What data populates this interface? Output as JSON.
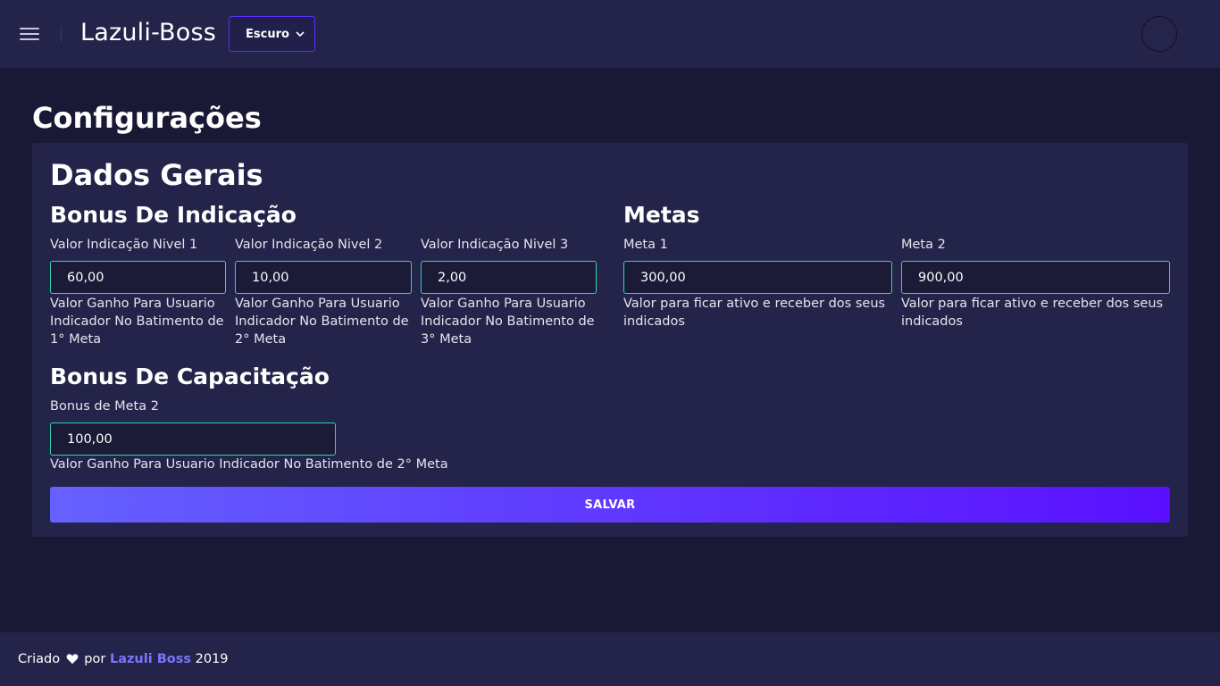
{
  "header": {
    "brand": "Lazuli-Boss",
    "theme_select": {
      "value": "Escuro"
    }
  },
  "page": {
    "title": "Configurações"
  },
  "card": {
    "title": "Dados Gerais",
    "bonus_indicacao": {
      "title": "Bonus De Indicação",
      "fields": [
        {
          "label": "Valor Indicação Nivel 1",
          "value": "60,00",
          "help": "Valor Ganho Para Usuario Indicador No Batimento de 1° Meta"
        },
        {
          "label": "Valor Indicação Nivel 2",
          "value": "10,00",
          "help": "Valor Ganho Para Usuario Indicador No Batimento de 2° Meta"
        },
        {
          "label": "Valor Indicação Nivel 3",
          "value": "2,00",
          "help": "Valor Ganho Para Usuario Indicador No Batimento de 3° Meta"
        }
      ]
    },
    "metas": {
      "title": "Metas",
      "fields": [
        {
          "label": "Meta 1",
          "value": "300,00",
          "help": "Valor para ficar ativo e receber dos seus indicados"
        },
        {
          "label": "Meta 2",
          "value": "900,00",
          "help": "Valor para ficar ativo e receber dos seus indicados"
        }
      ]
    },
    "bonus_capacitacao": {
      "title": "Bonus De Capacitação",
      "fields": [
        {
          "label": "Bonus de Meta 2",
          "value": "100,00",
          "help": "Valor Ganho Para Usuario Indicador No Batimento de 2° Meta"
        }
      ]
    },
    "save_label": "SALVAR"
  },
  "footer": {
    "prefix": "Criado",
    "by": "por",
    "brand": "Lazuli Boss",
    "year": "2019"
  },
  "colors": {
    "background": "#1a1935",
    "surface": "#24244a",
    "input_border": "#33d6a6",
    "accent": "#5a10ff",
    "link": "#7a74ff"
  },
  "icons": [
    "menu-icon",
    "chevron-down-icon",
    "heart-icon"
  ]
}
